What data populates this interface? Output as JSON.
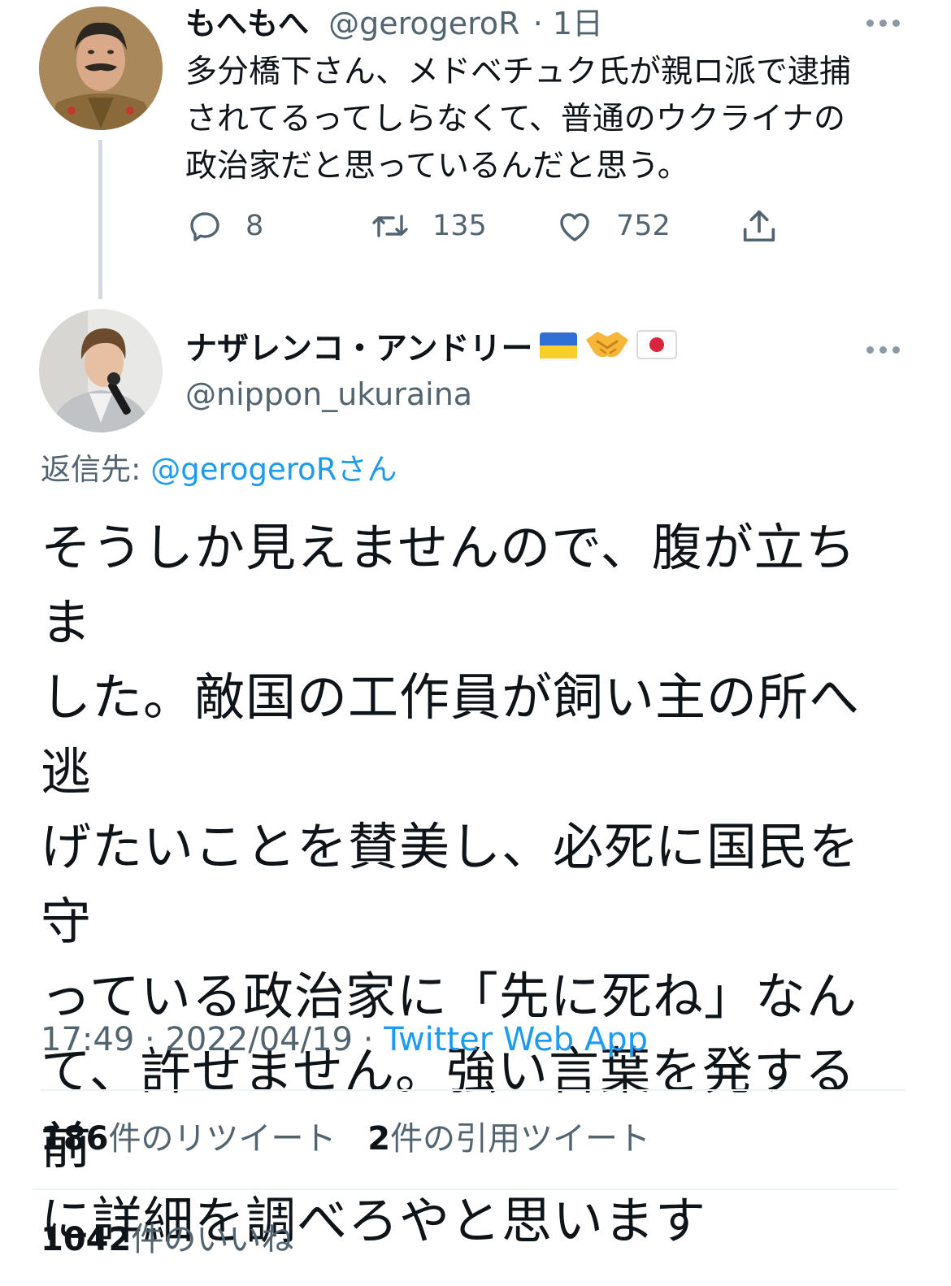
{
  "parent_tweet": {
    "display_name": "もへもへ",
    "handle": "@gerogeroR",
    "separator": "·",
    "time": "1日",
    "text": "多分橋下さん、メドベチュク氏が親ロ派で逮捕\nされてるってしらなくて、普通のウクライナの\n政治家だと思っているんだと思う。",
    "replies": "8",
    "retweets": "135",
    "likes": "752",
    "icons": [
      "more-icon",
      "reply-icon",
      "retweet-icon",
      "like-icon",
      "share-icon"
    ]
  },
  "main_tweet": {
    "display_name": "ナザレンコ・アンドリー",
    "name_emojis": [
      "ukraine-flag-emoji",
      "handshake-emoji",
      "japan-flag-emoji"
    ],
    "handle": "@nippon_ukuraina",
    "reply_prefix": "返信先: ",
    "reply_handle": "@gerogeroR",
    "reply_suffix": "さん",
    "text": "そうしか見えませんので、腹が立ちま\nした。敵国の工作員が飼い主の所へ逃\nげたいことを賛美し、必死に国民を守\nっている政治家に「先に死ね」なん\nて、許せません。強い言葉を発する前\nに詳細を調べろやと思います",
    "time": "17:49",
    "separator": "·",
    "date": "2022/04/19",
    "source": "Twitter Web App",
    "retweet_count": "186",
    "retweet_label": "件のリツイート",
    "quote_count": "2",
    "quote_label": "件の引用ツイート",
    "like_count": "1042",
    "like_label": "件のいいね"
  },
  "colors": {
    "text": "#0f1419",
    "muted": "#536471",
    "link": "#1d9bf0",
    "divider": "#eff3f4",
    "thread_line": "#cfd9de"
  }
}
